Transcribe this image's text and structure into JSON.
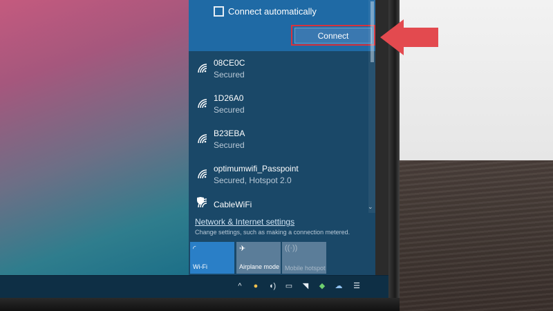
{
  "panel": {
    "connect_auto_label": "Connect automatically",
    "connect_label": "Connect"
  },
  "networks": [
    {
      "name": "08CE0C",
      "status": "Secured",
      "icon": "wifi-icon"
    },
    {
      "name": "1D26A0",
      "status": "Secured",
      "icon": "wifi-icon"
    },
    {
      "name": "B23EBA",
      "status": "Secured",
      "icon": "wifi-icon"
    },
    {
      "name": "optimumwifi_Passpoint",
      "status": "Secured, Hotspot 2.0",
      "icon": "wifi-icon"
    },
    {
      "name": "CableWiFi",
      "status": "",
      "icon": "wifi-shield-icon"
    }
  ],
  "settings": {
    "link": "Network & Internet settings",
    "description": "Change settings, such as making a connection metered."
  },
  "quick_actions": [
    {
      "label": "Wi-Fi",
      "icon": "wifi-icon",
      "active": true
    },
    {
      "label": "Airplane mode",
      "icon": "airplane-icon",
      "active": false
    },
    {
      "label": "Mobile hotspot",
      "icon": "hotspot-icon",
      "active": false,
      "disabled": true
    }
  ],
  "tray": {
    "icons": [
      "chevron-up-icon",
      "emoji-icon",
      "volume-icon",
      "battery-icon",
      "network-icon",
      "security-icon",
      "cloud-icon",
      "action-center-icon"
    ]
  },
  "colors": {
    "panel": "#1a4868",
    "selected_network": "#1f6aa5",
    "connect_button": "#3a78b0",
    "highlight": "#d9323c",
    "active_tile": "#2a7fc7"
  }
}
